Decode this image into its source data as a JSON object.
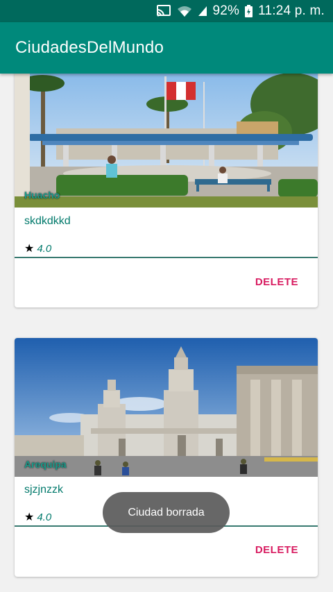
{
  "status_bar": {
    "battery": "92%",
    "time": "11:24 p. m.",
    "icons": [
      "cast-icon",
      "wifi-icon",
      "signal-icon",
      "battery-icon"
    ]
  },
  "app_bar": {
    "title": "CiudadesDelMundo"
  },
  "cards": [
    {
      "image_caption": "Huacho",
      "name": "skdkdkkd",
      "rating": "4.0",
      "delete_label": "DELETE"
    },
    {
      "image_caption": "Arequipa",
      "name": "sjzjnzzk",
      "rating": "4.0",
      "delete_label": "DELETE"
    }
  ],
  "toast": {
    "message": "Ciudad borrada"
  },
  "colors": {
    "status_bar": "#00695c",
    "app_bar": "#00897b",
    "accent": "#d81b60",
    "text_teal": "#00796b"
  }
}
